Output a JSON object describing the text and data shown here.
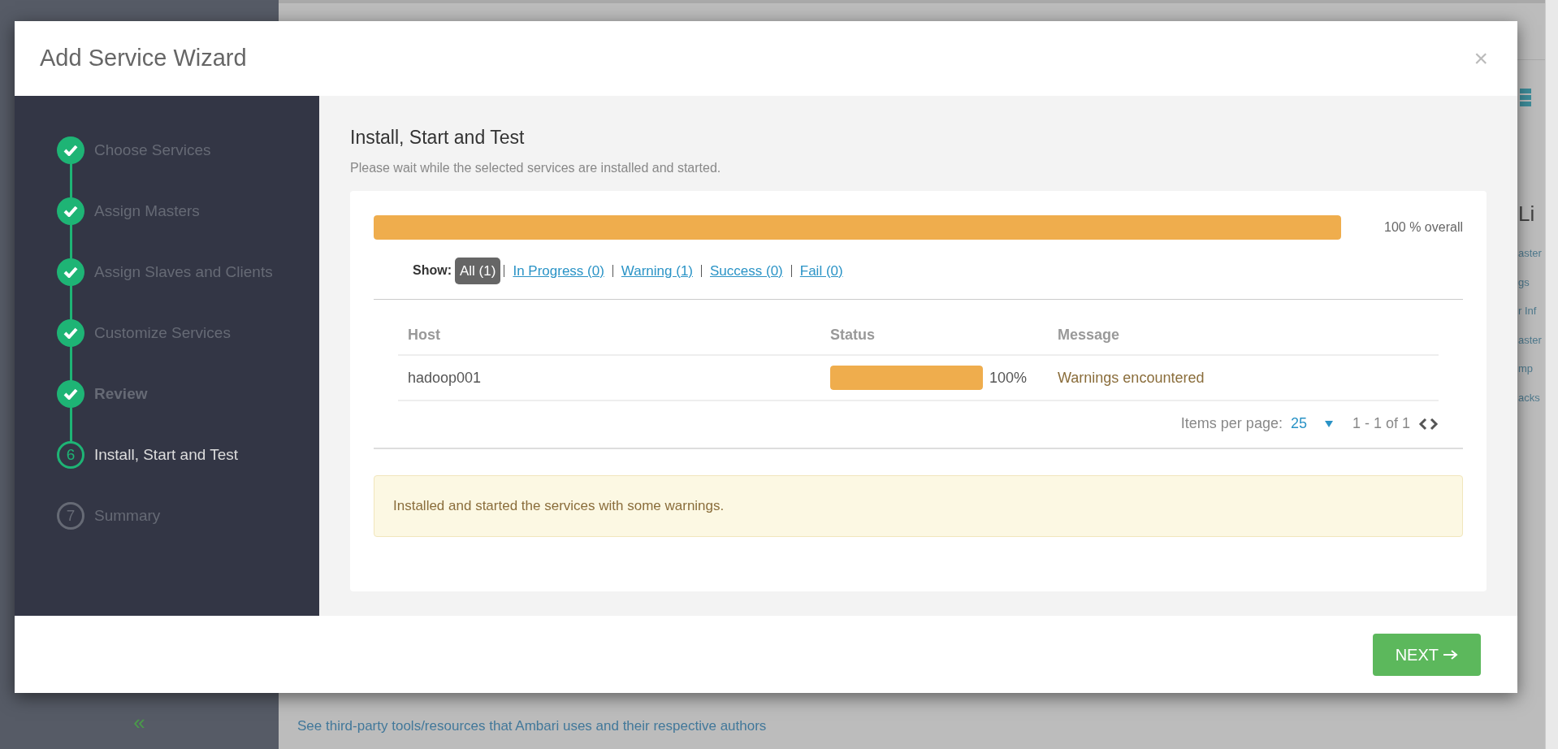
{
  "background": {
    "sidebar_toggle": "«",
    "side_heading": "Li",
    "side_links": [
      "aster",
      "gs",
      "r Inf",
      "aster",
      "mp",
      "acks"
    ],
    "footer_link": "See third-party tools/resources that Ambari uses and their respective authors"
  },
  "modal": {
    "title": "Add Service Wizard",
    "close": "×",
    "steps": [
      {
        "label": "Choose Services",
        "completed": true,
        "current": false
      },
      {
        "label": "Assign Masters",
        "completed": true,
        "current": false
      },
      {
        "label": "Assign Slaves and Clients",
        "completed": true,
        "current": false
      },
      {
        "label": "Customize Services",
        "completed": true,
        "current": false
      },
      {
        "label": "Review",
        "completed": true,
        "current": false
      },
      {
        "label": "Install, Start and Test",
        "completed": false,
        "current": true,
        "number": "6"
      },
      {
        "label": "Summary",
        "completed": false,
        "current": false,
        "number": "7"
      }
    ],
    "heading": "Install, Start and Test",
    "subtitle": "Please wait while the selected services are installed and started.",
    "overall": {
      "level": 1.0,
      "reading": "100 % overall"
    },
    "filter_label": "Show:",
    "filters": [
      {
        "label": "All (1)",
        "selected": true
      },
      {
        "label": "In Progress (0)",
        "selected": false
      },
      {
        "label": "Warning (1)",
        "selected": false
      },
      {
        "label": "Success (0)",
        "selected": false
      },
      {
        "label": "Fail (0)",
        "selected": false
      }
    ],
    "table": {
      "columns": [
        "Host",
        "Status",
        "Message"
      ],
      "rows": [
        {
          "host": "hadoop001",
          "level": 1.0,
          "reading": "100%",
          "message": "Warnings encountered"
        }
      ]
    },
    "pagination": {
      "label": "Items per page:",
      "per_page": "25",
      "range": "1 - 1 of 1"
    },
    "alert": "Installed and started the services with some warnings.",
    "next_button": "NEXT"
  }
}
